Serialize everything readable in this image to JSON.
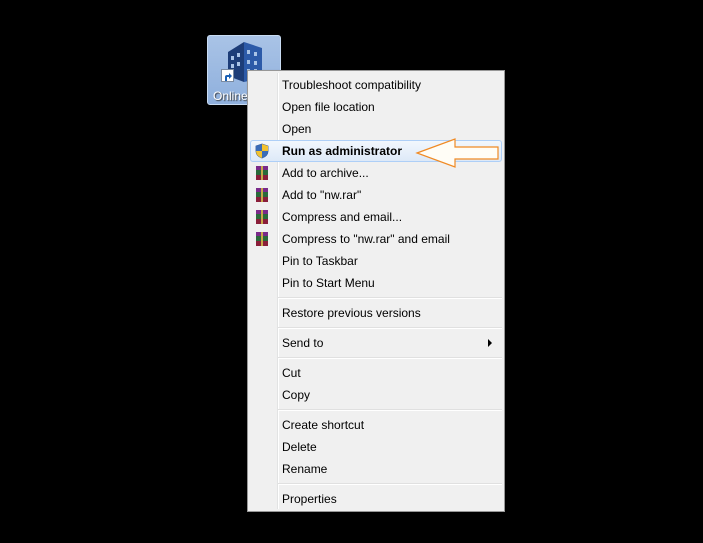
{
  "desktop": {
    "icon_label": "Online",
    "icon_name": "building-icon"
  },
  "menu": {
    "items": [
      {
        "label": "Troubleshoot compatibility"
      },
      {
        "label": "Open file location"
      },
      {
        "label": "Open"
      },
      {
        "label": "Run as administrator",
        "icon": "uac-shield-icon",
        "highlighted": true
      },
      {
        "label": "Add to archive...",
        "icon": "winrar-icon"
      },
      {
        "label": "Add to \"nw.rar\"",
        "icon": "winrar-icon"
      },
      {
        "label": "Compress and email...",
        "icon": "winrar-icon"
      },
      {
        "label": "Compress to \"nw.rar\" and email",
        "icon": "winrar-icon"
      },
      {
        "label": "Pin to Taskbar"
      },
      {
        "label": "Pin to Start Menu"
      },
      {
        "label": "Restore previous versions"
      },
      {
        "label": "Send to",
        "submenu": true
      },
      {
        "label": "Cut"
      },
      {
        "label": "Copy"
      },
      {
        "label": "Create shortcut"
      },
      {
        "label": "Delete"
      },
      {
        "label": "Rename"
      },
      {
        "label": "Properties"
      }
    ]
  },
  "annotation": {
    "arrow_color": "#f08a24"
  }
}
